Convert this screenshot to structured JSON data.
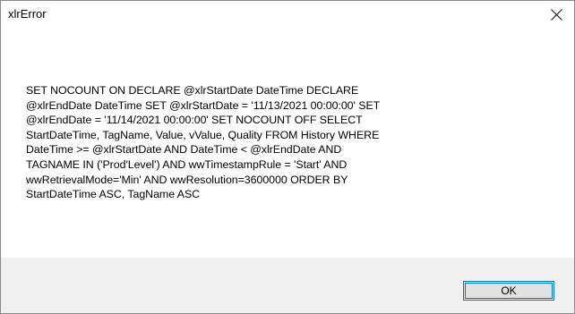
{
  "window": {
    "title": "xlrError"
  },
  "message": {
    "text": "SET NOCOUNT ON DECLARE @xlrStartDate DateTime DECLARE\n@xlrEndDate DateTime SET @xlrStartDate = '11/13/2021 00:00:00' SET\n@xlrEndDate = '11/14/2021 00:00:00' SET NOCOUNT OFF SELECT\nStartDateTime, TagName, Value, vValue, Quality FROM History WHERE\nDateTime >= @xlrStartDate AND DateTime < @xlrEndDate AND\nTAGNAME IN ('Prod'Level') AND wwTimestampRule = 'Start' AND\nwwRetrievalMode='Min' AND wwResolution=3600000  ORDER BY\nStartDateTime ASC, TagName ASC"
  },
  "buttons": {
    "ok_label": "OK"
  },
  "icons": {
    "close": "close-icon"
  },
  "colors": {
    "accent": "#0078d7",
    "footer_bg": "#f0f0f0",
    "button_bg": "#e1e1e1"
  }
}
